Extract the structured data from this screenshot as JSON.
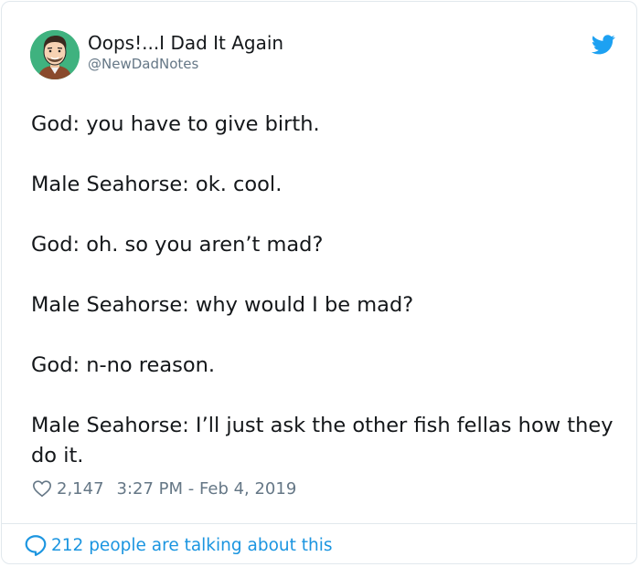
{
  "author": {
    "display_name": "Oops!...I Dad It Again",
    "handle": "@NewDadNotes",
    "avatar_icon": "cartoon-man-avatar",
    "verified_platform_icon": "twitter-bird-icon"
  },
  "tweet": {
    "lines": [
      "God: you have to give birth.",
      "Male Seahorse: ok. cool.",
      "God: oh. so you aren’t mad?",
      "Male Seahorse: why would I be mad?",
      "God: n-no reason.",
      "Male Seahorse: I’ll just ask the other fish fellas how they do it."
    ]
  },
  "meta": {
    "likes": "2,147",
    "timestamp": "3:27 PM - Feb 4, 2019"
  },
  "footer": {
    "talking_text": "212 people are talking about this"
  },
  "colors": {
    "twitter_blue": "#1da1f2",
    "link_blue": "#1b95e0",
    "secondary_text": "#657786",
    "avatar_bg": "#3fb27f"
  }
}
